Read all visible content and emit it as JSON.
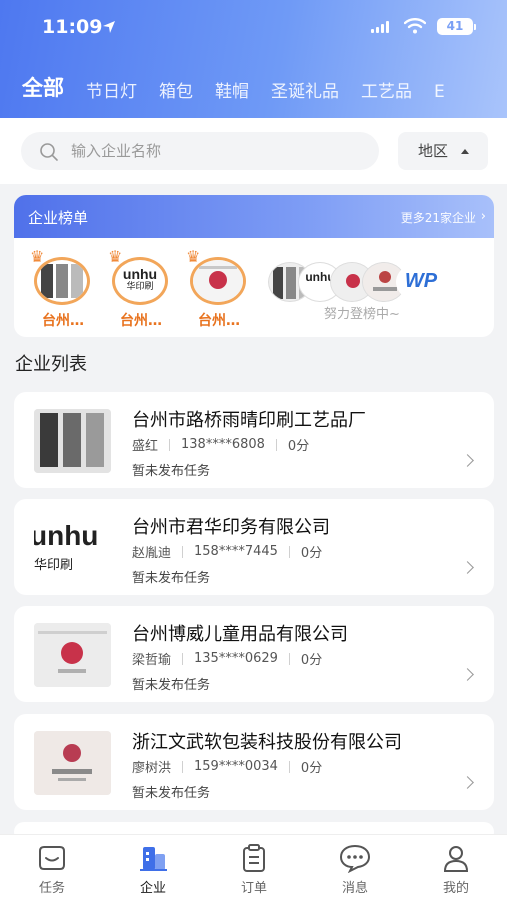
{
  "status_bar": {
    "time": "11:09",
    "battery": "41"
  },
  "categories": [
    "全部",
    "节日灯",
    "箱包",
    "鞋帽",
    "圣诞礼品",
    "工艺品",
    "E"
  ],
  "search": {
    "placeholder": "输入企业名称",
    "region_label": "地区"
  },
  "ranking": {
    "title": "企业榜单",
    "more_label": "更多21家企业",
    "top": [
      {
        "name": "台州…"
      },
      {
        "name": "台州…"
      },
      {
        "name": "台州…"
      }
    ],
    "pending_label": "努力登榜中~"
  },
  "list_title": "企业列表",
  "companies": [
    {
      "name": "台州市路桥雨晴印刷工艺品厂",
      "contact": "盛红",
      "phone": "138****6808",
      "score": "0分",
      "task": "暂未发布任务"
    },
    {
      "name": "台州市君华印务有限公司",
      "contact": "赵胤迪",
      "phone": "158****7445",
      "score": "0分",
      "task": "暂未发布任务"
    },
    {
      "name": "台州博威儿童用品有限公司",
      "contact": "梁哲瑜",
      "phone": "135****0629",
      "score": "0分",
      "task": "暂未发布任务"
    },
    {
      "name": "浙江文武软包装科技股份有限公司",
      "contact": "廖树洪",
      "phone": "159****0034",
      "score": "0分",
      "task": "暂未发布任务"
    }
  ],
  "logo_texts": {
    "junhua_top": "unhu",
    "junhua_bottom": "华印刷",
    "wp": "WP"
  },
  "tabs": [
    {
      "label": "任务",
      "icon": "task-icon"
    },
    {
      "label": "企业",
      "icon": "enterprise-icon"
    },
    {
      "label": "订单",
      "icon": "order-icon"
    },
    {
      "label": "消息",
      "icon": "message-icon"
    },
    {
      "label": "我的",
      "icon": "profile-icon"
    }
  ],
  "colors": {
    "accent": "#4e78f0",
    "crown": "#f08a3a",
    "rank_name": "#e8731f"
  }
}
